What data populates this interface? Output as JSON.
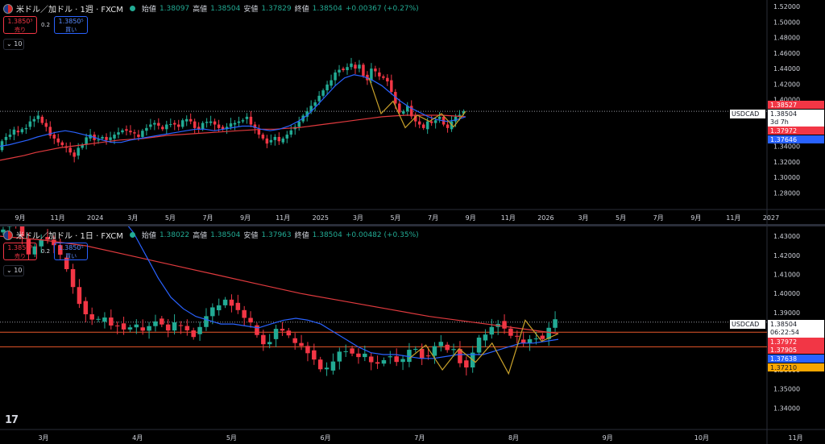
{
  "colors": {
    "up": "#22ab94",
    "down": "#f23645",
    "ma_fast": "#2962ff",
    "ma_slow": "#e03a3e",
    "zigzag": "#c8a02a",
    "hline": "#e8572a",
    "bg": "#000000",
    "text": "#d1d4dc"
  },
  "top": {
    "symbol_title": "米ドル／加ドル · 1週 · FXCM",
    "ohlc": [
      {
        "label": "始値",
        "value": "1.38097"
      },
      {
        "label": "高値",
        "value": "1.38504"
      },
      {
        "label": "安値",
        "value": "1.37829"
      },
      {
        "label": "終値",
        "value": "1.38504"
      },
      {
        "label": "",
        "value": "+0.00367 (+0.27%)"
      }
    ],
    "sell": {
      "price": "1.3850³",
      "label": "売り"
    },
    "buy": {
      "price": "1.3850⁵",
      "label": "買い"
    },
    "spread": "0.2",
    "collapse": "10"
  },
  "bottom": {
    "symbol_title": "米ドル／加ドル · 1日 · FXCM",
    "ohlc": [
      {
        "label": "始値",
        "value": "1.38022"
      },
      {
        "label": "高値",
        "value": "1.38504"
      },
      {
        "label": "安値",
        "value": "1.37963"
      },
      {
        "label": "終値",
        "value": "1.38504"
      },
      {
        "label": "",
        "value": "+0.00482 (+0.35%)"
      }
    ],
    "sell": {
      "price": "1.3850³",
      "label": "売り"
    },
    "buy": {
      "price": "1.3850⁵",
      "label": "買い"
    },
    "spread": "0.2",
    "collapse": "10"
  },
  "chart_data": [
    {
      "type": "candlestick",
      "timeframe": "1週",
      "ylim": [
        1.27,
        1.52
      ],
      "yticks": [
        1.28,
        1.3,
        1.32,
        1.34,
        1.36,
        1.38,
        1.4,
        1.42,
        1.44,
        1.46,
        1.48,
        1.5,
        1.52
      ],
      "ytick_labels": [
        "1.28000",
        "1.30000",
        "1.32000",
        "1.34000",
        "1.36000",
        "1.38000",
        "1.40000",
        "1.42000",
        "1.44000",
        "1.46000",
        "1.48000",
        "1.50000",
        "1.52000"
      ],
      "xtick_labels": [
        "9月",
        "11月",
        "2024",
        "3月",
        "5月",
        "7月",
        "9月",
        "11月",
        "2025",
        "3月",
        "5月",
        "7月",
        "9月",
        "11月",
        "2026",
        "3月",
        "5月",
        "7月",
        "9月",
        "11月",
        "2027"
      ],
      "close_path": [
        1.335,
        1.348,
        1.352,
        1.355,
        1.36,
        1.358,
        1.362,
        1.365,
        1.372,
        1.375,
        1.378,
        1.37,
        1.365,
        1.355,
        1.35,
        1.345,
        1.34,
        1.338,
        1.332,
        1.328,
        1.338,
        1.342,
        1.35,
        1.355,
        1.348,
        1.35,
        1.352,
        1.348,
        1.35,
        1.355,
        1.358,
        1.362,
        1.36,
        1.358,
        1.355,
        1.352,
        1.36,
        1.365,
        1.368,
        1.37,
        1.365,
        1.362,
        1.368,
        1.37,
        1.368,
        1.365,
        1.372,
        1.375,
        1.372,
        1.365,
        1.362,
        1.37,
        1.37,
        1.372,
        1.368,
        1.365,
        1.362,
        1.365,
        1.368,
        1.37,
        1.372,
        1.375,
        1.378,
        1.368,
        1.362,
        1.355,
        1.35,
        1.345,
        1.348,
        1.352,
        1.345,
        1.35,
        1.355,
        1.362,
        1.365,
        1.372,
        1.378,
        1.385,
        1.392,
        1.398,
        1.405,
        1.412,
        1.418,
        1.425,
        1.435,
        1.44,
        1.438,
        1.442,
        1.445,
        1.44,
        1.445,
        1.432,
        1.425,
        1.44,
        1.435,
        1.43,
        1.428,
        1.425,
        1.41,
        1.395,
        1.382,
        1.385,
        1.392,
        1.38,
        1.372,
        1.368,
        1.362,
        1.372,
        1.37,
        1.375,
        1.378,
        1.368,
        1.362,
        1.372,
        1.378,
        1.382,
        1.385
      ],
      "ma_fast_path": [
        1.34,
        1.342,
        1.345,
        1.348,
        1.352,
        1.355,
        1.358,
        1.36,
        1.358,
        1.355,
        1.352,
        1.348,
        1.345,
        1.345,
        1.348,
        1.35,
        1.352,
        1.354,
        1.356,
        1.358,
        1.36,
        1.362,
        1.362,
        1.36,
        1.362,
        1.364,
        1.366,
        1.366,
        1.362,
        1.36,
        1.362,
        1.366,
        1.372,
        1.38,
        1.392,
        1.405,
        1.418,
        1.428,
        1.432,
        1.43,
        1.425,
        1.418,
        1.408,
        1.398,
        1.39,
        1.384,
        1.378,
        1.374,
        1.372,
        1.374,
        1.378
      ],
      "ma_slow_path": [
        1.322,
        1.325,
        1.328,
        1.332,
        1.335,
        1.338,
        1.34,
        1.342,
        1.344,
        1.346,
        1.348,
        1.349,
        1.35,
        1.352,
        1.354,
        1.355,
        1.356,
        1.357,
        1.358,
        1.359,
        1.36,
        1.361,
        1.362,
        1.362,
        1.363,
        1.364,
        1.366,
        1.368,
        1.37,
        1.372,
        1.374,
        1.376,
        1.378,
        1.379,
        1.38,
        1.38,
        1.38,
        1.38,
        1.379,
        1.378
      ],
      "zigzag": [
        1.428,
        1.382,
        1.398,
        1.364,
        1.38,
        1.372,
        1.382,
        1.365,
        1.385
      ],
      "price_labels": [
        {
          "value": "1.38527",
          "color": "#f23645",
          "text_color": "#ffffff"
        },
        {
          "value": "1.38504",
          "sub": "3d 7h",
          "color": "#ffffff",
          "text_color": "#131722",
          "tag": "USDCAD"
        },
        {
          "value": "1.37972",
          "color": "#f23645",
          "text_color": "#ffffff"
        },
        {
          "value": "1.37646",
          "color": "#2962ff",
          "text_color": "#ffffff"
        }
      ]
    },
    {
      "type": "candlestick",
      "timeframe": "1日",
      "ylim": [
        1.333,
        1.433
      ],
      "yticks": [
        1.34,
        1.35,
        1.36,
        1.37,
        1.38,
        1.39,
        1.4,
        1.41,
        1.42,
        1.43
      ],
      "ytick_labels": [
        "1.34000",
        "1.35000",
        "1.36000",
        "1.37000",
        "1.38000",
        "1.39000",
        "1.40000",
        "1.41000",
        "1.42000",
        "1.43000"
      ],
      "xtick_labels": [
        "3月",
        "4月",
        "5月",
        "6月",
        "7月",
        "8月",
        "9月",
        "10月",
        "11月"
      ],
      "close_path": [
        1.432,
        1.435,
        1.438,
        1.436,
        1.428,
        1.42,
        1.425,
        1.43,
        1.428,
        1.425,
        1.418,
        1.412,
        1.402,
        1.395,
        1.388,
        1.386,
        1.385,
        1.388,
        1.382,
        1.385,
        1.38,
        1.383,
        1.382,
        1.38,
        1.384,
        1.388,
        1.382,
        1.38,
        1.385,
        1.382,
        1.38,
        1.378,
        1.385,
        1.39,
        1.392,
        1.395,
        1.398,
        1.393,
        1.39,
        1.385,
        1.382,
        1.375,
        1.372,
        1.38,
        1.383,
        1.378,
        1.375,
        1.373,
        1.372,
        1.368,
        1.362,
        1.358,
        1.362,
        1.368,
        1.372,
        1.37,
        1.366,
        1.368,
        1.365,
        1.362,
        1.366,
        1.368,
        1.365,
        1.362,
        1.37,
        1.372,
        1.368,
        1.366,
        1.372,
        1.374,
        1.37,
        1.372,
        1.366,
        1.36,
        1.368,
        1.375,
        1.378,
        1.382,
        1.386,
        1.382,
        1.378,
        1.376,
        1.374,
        1.376,
        1.378,
        1.376,
        1.382,
        1.385
      ],
      "ma_fast_path": [
        1.44,
        1.432,
        1.42,
        1.408,
        1.398,
        1.392,
        1.388,
        1.386,
        1.384,
        1.384,
        1.383,
        1.382,
        1.384,
        1.386,
        1.387,
        1.386,
        1.384,
        1.38,
        1.376,
        1.372,
        1.369,
        1.368,
        1.368,
        1.367,
        1.366,
        1.366,
        1.367,
        1.368,
        1.368,
        1.368,
        1.37,
        1.372,
        1.374,
        1.374,
        1.375,
        1.376
      ],
      "ma_slow_path": [
        1.43,
        1.428,
        1.425,
        1.42,
        1.415,
        1.41,
        1.405,
        1.4,
        1.396,
        1.392,
        1.388,
        1.385,
        1.382,
        1.379
      ],
      "zigzag": [
        1.366,
        1.373,
        1.36,
        1.371,
        1.364,
        1.374,
        1.358,
        1.386,
        1.375,
        1.379
      ],
      "hlines": [
        1.37972,
        1.3721
      ],
      "price_labels": [
        {
          "value": "1.38504",
          "sub": "06:22:54",
          "color": "#ffffff",
          "text_color": "#131722",
          "tag": "USDCAD"
        },
        {
          "value": "1.37972",
          "color": "#f23645",
          "text_color": "#ffffff"
        },
        {
          "value": "1.37905",
          "color": "#f23645",
          "text_color": "#ffffff"
        },
        {
          "value": "1.37638",
          "color": "#2962ff",
          "text_color": "#ffffff"
        },
        {
          "value": "1.37210",
          "color": "#f7a600",
          "text_color": "#131722"
        }
      ]
    }
  ]
}
